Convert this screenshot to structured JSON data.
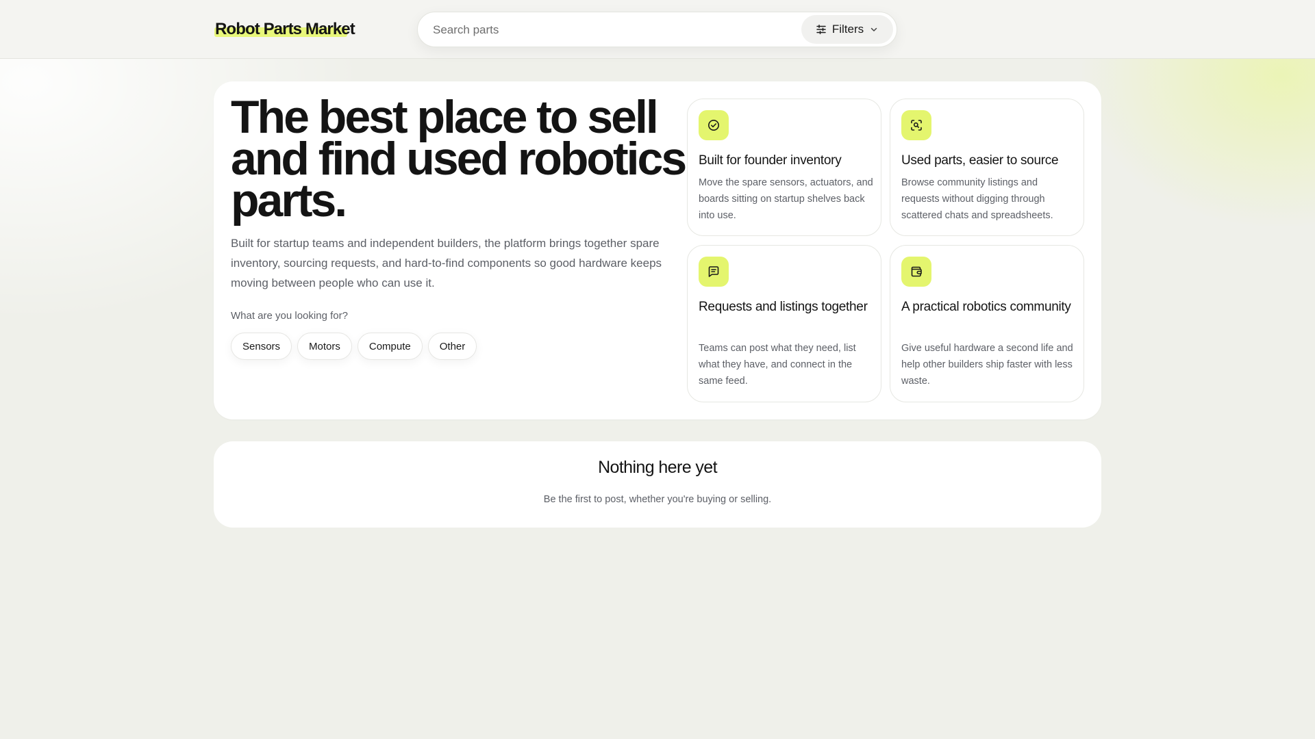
{
  "header": {
    "logo": "Robot Parts Market",
    "search_placeholder": "Search parts",
    "filters_label": "Filters"
  },
  "hero": {
    "title": "The best place to sell and find used robotics parts.",
    "description": "Built for startup teams and independent builders, the platform brings together spare inventory, sourcing requests, and hard-to-find components so good hardware keeps moving between people who can use it.",
    "looking_label": "What are you looking for?",
    "chips": [
      "Sensors",
      "Motors",
      "Compute",
      "Other"
    ]
  },
  "features": [
    {
      "icon": "check-circle-icon",
      "title": "Built for founder inventory",
      "description": "Move the spare sensors, actuators, and boards sitting on startup shelves back into use."
    },
    {
      "icon": "scan-search-icon",
      "title": "Used parts, easier to source",
      "description": "Browse community listings and requests without digging through scattered chats and spreadsheets."
    },
    {
      "icon": "message-square-icon",
      "title": "Requests and listings together",
      "description": "Teams can post what they need, list what they have, and connect in the same feed."
    },
    {
      "icon": "wallet-icon",
      "title": "A practical robotics community",
      "description": "Give useful hardware a second life and help other builders ship faster with less waste."
    }
  ],
  "empty_state": {
    "title": "Nothing here yet",
    "subtitle": "Be the first to post, whether you're buying or selling."
  },
  "colors": {
    "accent": "#e4f56e",
    "page_background": "#eff0ea",
    "text_primary": "#141414",
    "text_muted": "#5c5f66"
  }
}
